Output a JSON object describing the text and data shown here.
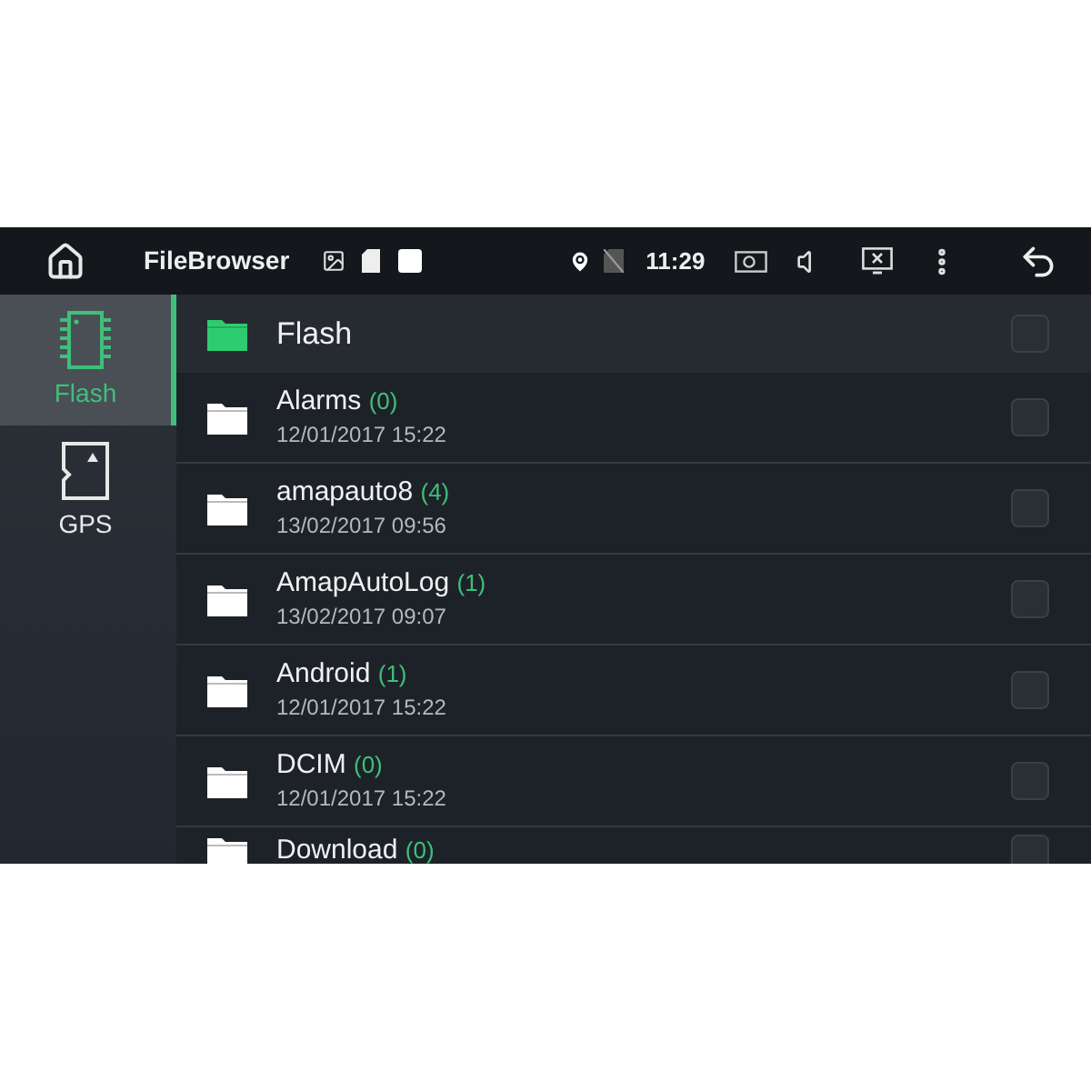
{
  "status_bar": {
    "app_title": "FileBrowser",
    "time": "11:29"
  },
  "sidebar": {
    "items": [
      {
        "label": "Flash",
        "kind": "chip",
        "selected": true
      },
      {
        "label": "GPS",
        "kind": "sdcard",
        "selected": false
      }
    ]
  },
  "header": {
    "title": "Flash",
    "checked": false
  },
  "files": [
    {
      "name": "Alarms",
      "count": "(0)",
      "date": "12/01/2017 15:22",
      "checked": false
    },
    {
      "name": "amapauto8",
      "count": "(4)",
      "date": "13/02/2017 09:56",
      "checked": false
    },
    {
      "name": "AmapAutoLog",
      "count": "(1)",
      "date": "13/02/2017 09:07",
      "checked": false
    },
    {
      "name": "Android",
      "count": "(1)",
      "date": "12/01/2017 15:22",
      "checked": false
    },
    {
      "name": "DCIM",
      "count": "(0)",
      "date": "12/01/2017 15:22",
      "checked": false
    },
    {
      "name": "Download",
      "count": "(0)",
      "checked": false
    }
  ]
}
